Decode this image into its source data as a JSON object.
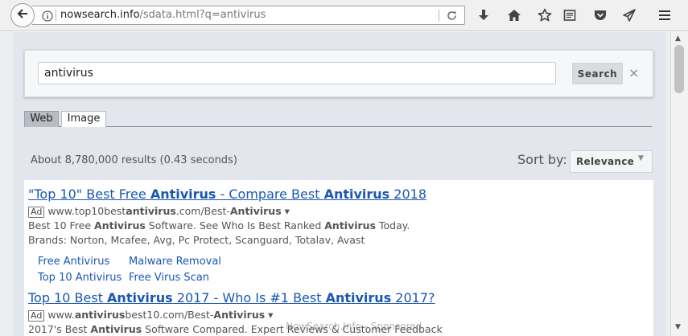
{
  "browser": {
    "url_host": "nowsearch.info",
    "url_path": "/sdata.html?q=antivirus",
    "icons": [
      "back-icon",
      "info-icon",
      "reload-icon",
      "download-icon",
      "home-icon",
      "bookmark-star-icon",
      "reader-view-icon",
      "pocket-icon",
      "send-icon",
      "menu-icon"
    ]
  },
  "search": {
    "query": "antivirus",
    "button_label": "Search",
    "clear_glyph": "×"
  },
  "tabs": [
    {
      "label": "Web",
      "active": true
    },
    {
      "label": "Image",
      "active": false
    }
  ],
  "results_info": "About 8,780,000 results (0.43 seconds)",
  "sort": {
    "label": "Sort by:",
    "value": "Relevance"
  },
  "results": [
    {
      "title": [
        {
          "t": "\"Top 10\" Best Free ",
          "b": false
        },
        {
          "t": "Antivirus",
          "b": true
        },
        {
          "t": " - Compare Best ",
          "b": false
        },
        {
          "t": "Antivirus",
          "b": true
        },
        {
          "t": " 2018",
          "b": false
        }
      ],
      "ad_label": "Ad",
      "url": [
        {
          "t": "www.top10best",
          "b": false
        },
        {
          "t": "antivirus",
          "b": true
        },
        {
          "t": ".com/Best-",
          "b": false
        },
        {
          "t": "Antivirus",
          "b": true
        },
        {
          "t": " ▾",
          "b": false
        }
      ],
      "desc": [
        [
          {
            "t": "Best 10 Free ",
            "b": false
          },
          {
            "t": "Antivirus",
            "b": true
          },
          {
            "t": " Software. See Who Is Best Ranked ",
            "b": false
          },
          {
            "t": "Antivirus",
            "b": true
          },
          {
            "t": " Today.",
            "b": false
          }
        ],
        [
          {
            "t": "Brands: Norton, Mcafee, Avg, Pc Protect, Scanguard, Totalav, Avast",
            "b": false
          }
        ]
      ],
      "sitelinks": [
        "Free Antivirus",
        "Malware Removal",
        "Top 10 Antivirus",
        "Free Virus Scan"
      ]
    },
    {
      "title": [
        {
          "t": "Top 10 Best ",
          "b": false
        },
        {
          "t": "Antivirus",
          "b": true
        },
        {
          "t": " 2017 - Who Is #1 Best ",
          "b": false
        },
        {
          "t": "Antivirus",
          "b": true
        },
        {
          "t": " 2017?",
          "b": false
        }
      ],
      "ad_label": "Ad",
      "url": [
        {
          "t": "www.",
          "b": false
        },
        {
          "t": "antivirus",
          "b": true
        },
        {
          "t": "best10.com/Best-",
          "b": false
        },
        {
          "t": "Antivirus",
          "b": true
        },
        {
          "t": " ▾",
          "b": false
        }
      ],
      "desc": [
        [
          {
            "t": "2017's Best ",
            "b": false
          },
          {
            "t": "Antivirus",
            "b": true
          },
          {
            "t": " Software Compared. Expert Reviews & Customer Feedback",
            "b": false
          }
        ]
      ],
      "sitelinks": []
    }
  ],
  "watermark": "NowSearch.Info - Sponsored"
}
